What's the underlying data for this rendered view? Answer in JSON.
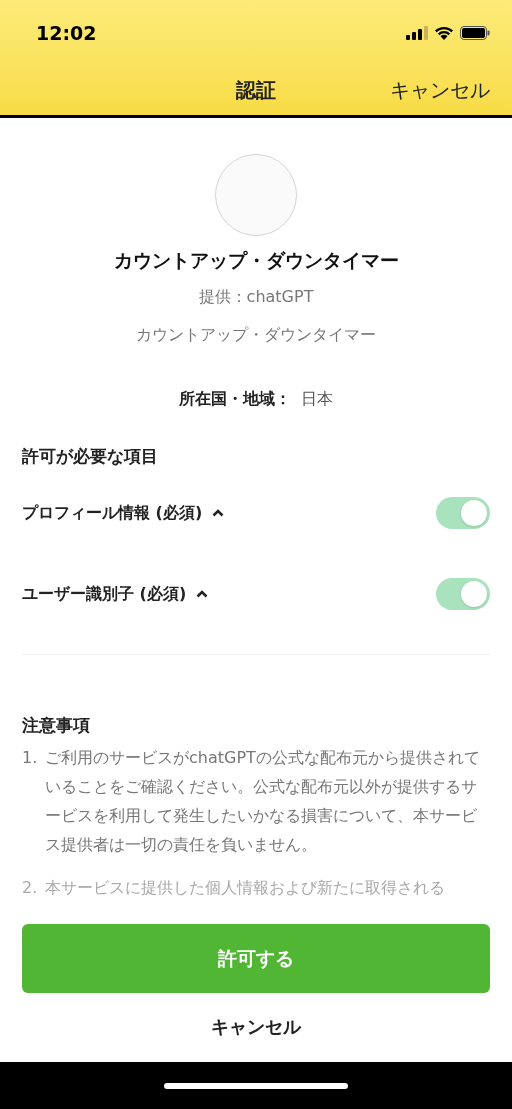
{
  "status_bar": {
    "time": "12:02"
  },
  "nav": {
    "title": "認証",
    "cancel": "キャンセル"
  },
  "app": {
    "name": "カウントアップ・ダウンタイマー",
    "provider": "提供：chatGPT",
    "description": "カウントアップ・ダウンタイマー"
  },
  "region": {
    "label": "所在国・地域：",
    "value": "日本"
  },
  "permissions": {
    "heading": "許可が必要な項目",
    "items": [
      {
        "label": "プロフィール情報 (必須)",
        "expanded": true,
        "on": true
      },
      {
        "label": "ユーザー識別子 (必須)",
        "expanded": true,
        "on": true
      }
    ]
  },
  "notes": {
    "heading": "注意事項",
    "items": [
      {
        "number": "1.",
        "text": "ご利用のサービスがchatGPTの公式な配布元から提供されていることをご確認ください。公式な配布元以外が提供するサービスを利用して発生したいかなる損害について、本サービス提供者は一切の責任を負いません。",
        "faded": false
      },
      {
        "number": "2.",
        "text": "本サービスに提供した個人情報および新たに取得される",
        "faded": true
      }
    ]
  },
  "actions": {
    "allow": "許可する",
    "cancel": "キャンセル"
  }
}
